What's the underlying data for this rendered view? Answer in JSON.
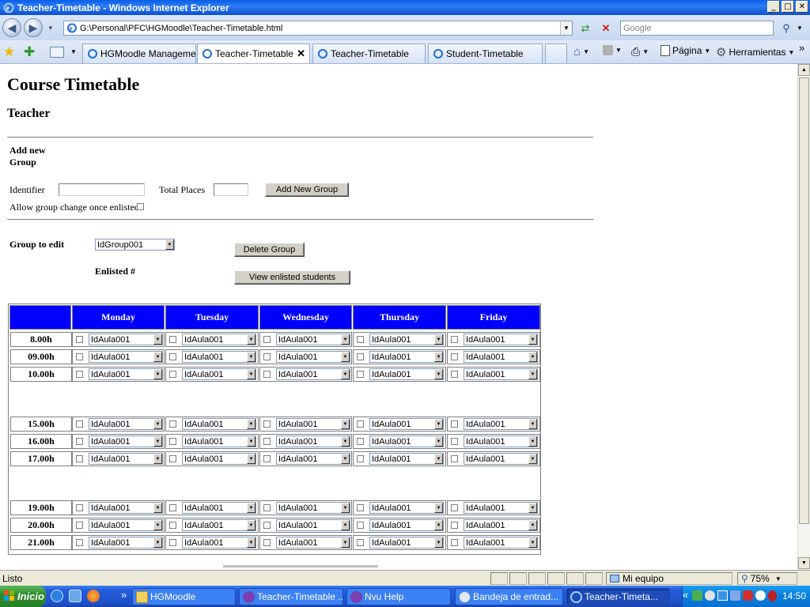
{
  "window": {
    "title": "Teacher-Timetable - Windows Internet Explorer",
    "controls": [
      "_",
      "□",
      "✕"
    ]
  },
  "browser": {
    "address": "G:\\Personal\\PFC\\HGMoodle\\Teacher-Timetable.html",
    "search_placeholder": "Google",
    "tabs": [
      {
        "label": "HGMoodle Management",
        "active": false
      },
      {
        "label": "Teacher-Timetable",
        "active": true
      },
      {
        "label": "Teacher-Timetable",
        "active": false
      },
      {
        "label": "Student-Timetable",
        "active": false
      }
    ],
    "commands": {
      "page": "Página",
      "tools": "Herramientas",
      "more": "»"
    },
    "tab_close": "✕"
  },
  "page": {
    "title": "Course Timetable",
    "subtitle": "Teacher",
    "add_group": {
      "heading_line1": "Add new",
      "heading_line2": "Group",
      "identifier_label": "Identifier",
      "identifier_value": "",
      "total_places_label": "Total Places",
      "total_places_value": "",
      "add_button": "Add New Group",
      "allow_change_label": "Allow group change once enlisted?"
    },
    "edit_group": {
      "label": "Group to edit",
      "selected_group": "IdGroup001",
      "delete_button": "Delete Group",
      "enlisted_label": "Enlisted #",
      "view_students_button": "View enlisted students"
    },
    "timetable": {
      "days": [
        "Monday",
        "Tuesday",
        "Wednesday",
        "Thursday",
        "Friday"
      ],
      "blocks": [
        [
          "8.00h",
          "09.00h",
          "10.00h"
        ],
        [
          "15.00h",
          "16.00h",
          "17.00h"
        ],
        [
          "19.00h",
          "20.00h",
          "21.00h"
        ]
      ],
      "room_value": "IdAula001"
    }
  },
  "status": {
    "text": "Listo",
    "zone": "Mi equipo",
    "zoom": "75%"
  },
  "taskbar": {
    "start": "Inicio",
    "tasks": [
      {
        "label": "HGMoodle",
        "active": false
      },
      {
        "label": "Teacher-Timetable ...",
        "active": false
      },
      {
        "label": "Nvu Help",
        "active": false
      },
      {
        "label": "Bandeja de entrad...",
        "active": false
      },
      {
        "label": "Teacher-Timeta...",
        "active": true
      }
    ],
    "clock": "14:50",
    "more": "«"
  },
  "colors": {
    "day_header_bg": "#0000ff",
    "day_header_text": "#ffffff",
    "titlebar": "#0a5ee8",
    "taskbar": "#245edb"
  }
}
